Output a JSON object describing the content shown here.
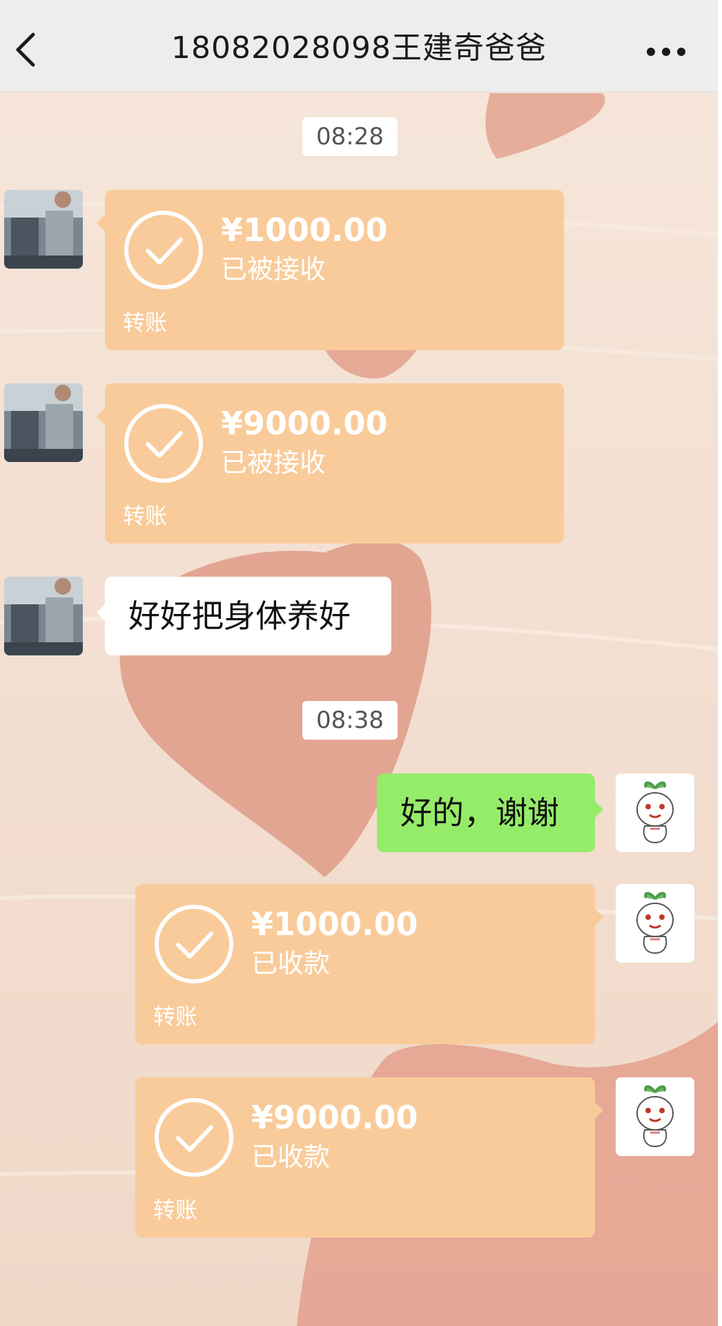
{
  "header": {
    "title": "18082028098王建奇爸爸",
    "back_icon": "chevron-left-icon",
    "more_icon": "more-horizontal-icon"
  },
  "colors": {
    "background": "#f3e0d2",
    "heart": "#e0a08c",
    "transfer_card": "#f9cb9a",
    "sent_bubble": "#95ec69",
    "received_bubble": "#ffffff"
  },
  "messages": [
    {
      "type": "time",
      "text": "08:28"
    },
    {
      "type": "transfer",
      "side": "left",
      "amount": "¥1000.00",
      "status": "已被接收",
      "label": "转账"
    },
    {
      "type": "transfer",
      "side": "left",
      "amount": "¥9000.00",
      "status": "已被接收",
      "label": "转账"
    },
    {
      "type": "text",
      "side": "left",
      "text": "好好把身体养好"
    },
    {
      "type": "time",
      "text": "08:38"
    },
    {
      "type": "text",
      "side": "right",
      "text": "好的，谢谢"
    },
    {
      "type": "transfer",
      "side": "right",
      "amount": "¥1000.00",
      "status": "已收款",
      "label": "转账"
    },
    {
      "type": "transfer",
      "side": "right",
      "amount": "¥9000.00",
      "status": "已收款",
      "label": "转账"
    }
  ]
}
